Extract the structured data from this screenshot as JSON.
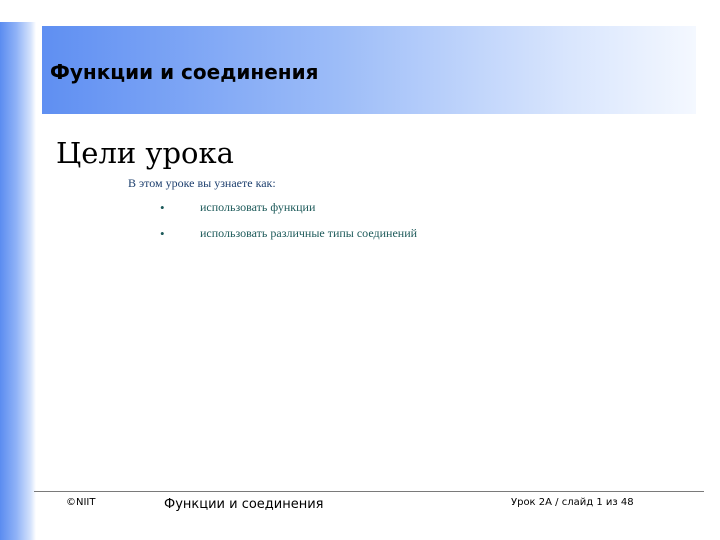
{
  "header": {
    "title": "Функции и соединения"
  },
  "slide": {
    "heading": "Цели урока",
    "intro": "В этом уроке вы узнаете как:",
    "bullets": [
      "использовать функции",
      "использовать различные типы соединений"
    ],
    "bullet_symbol": "•"
  },
  "footer": {
    "copyright": "©NIIT",
    "course_title": "Функции и соединения",
    "slide_counter": "Урок 2A / слайд 1 из 48"
  },
  "colors": {
    "accent_blue": "#5f8ff2",
    "text_blue": "#1d3f6e",
    "text_teal": "#1d5a5a"
  }
}
